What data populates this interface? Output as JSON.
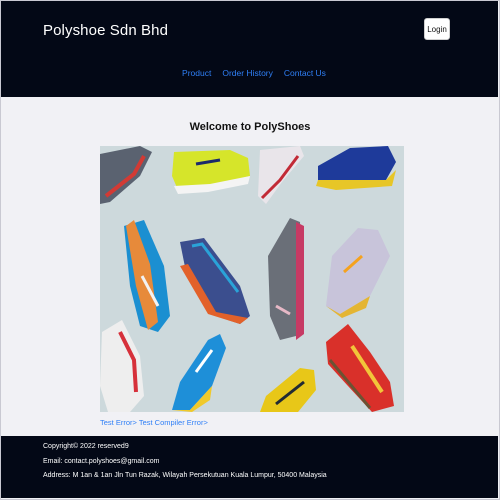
{
  "header": {
    "brand": "Polyshoe Sdn Bhd",
    "login_label": "Login",
    "nav": [
      "Product",
      "Order History",
      "Contact Us"
    ]
  },
  "main": {
    "title": "Welcome to PolyShoes",
    "hero_image": "running-shoes-flatlay",
    "links": [
      "Test Error>",
      "Test Compiler Error>"
    ]
  },
  "footer": {
    "copyright": "Copyright© 2022 reserved9",
    "email": "Email: contact.polyshoes@gmail.com",
    "address": "Address: M 1an & 1an Jln Tun Razak, Wilayah Persekutuan Kuala Lumpur, 50400 Malaysia"
  },
  "colors": {
    "header_bg": "#030816",
    "link": "#2f7ff6",
    "page_bg": "#f1f1f5",
    "hero_bg": "#cdd9dc"
  }
}
